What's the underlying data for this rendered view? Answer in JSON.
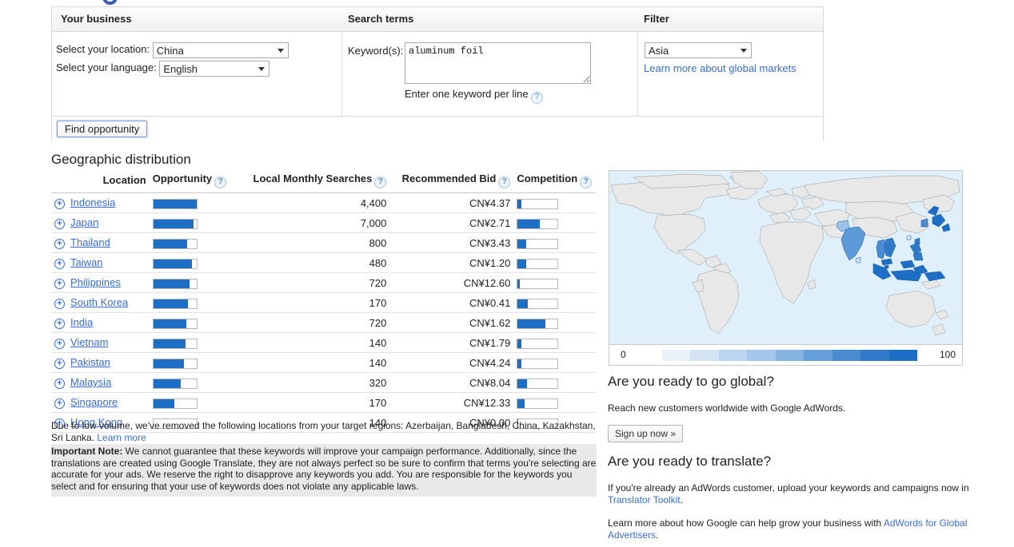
{
  "logo": {
    "icon": "google-logo-partial"
  },
  "form": {
    "headers": {
      "business": "Your business",
      "search_terms": "Search terms",
      "filter": "Filter"
    },
    "location_label": "Select your location:",
    "location_value": "China",
    "language_label": "Select your language:",
    "language_value": "English",
    "keywords_label": "Keyword(s):",
    "keywords_value": "aluminum foil",
    "keywords_hint": "Enter one keyword per line",
    "filter_value": "Asia",
    "filter_link": "Learn more about global markets",
    "submit_label": "Find opportunity",
    "help_icon": "?"
  },
  "geo": {
    "title": "Geographic distribution",
    "columns": [
      "Location",
      "Opportunity",
      "Local Monthly Searches",
      "Recommended Bid",
      "Competition"
    ],
    "expand_icon": "+"
  },
  "chart_data": {
    "type": "table",
    "title": "Geographic distribution",
    "columns": [
      "Location",
      "Opportunity",
      "Local Monthly Searches",
      "Recommended Bid",
      "Competition"
    ],
    "opportunity_scale": [
      0,
      100
    ],
    "competition_scale": [
      0,
      100
    ],
    "currency": "CN¥",
    "rows": [
      {
        "location": "Indonesia",
        "opportunity": 100,
        "searches": "4,400",
        "bid": "CN¥4.37",
        "competition": 9
      },
      {
        "location": "Japan",
        "opportunity": 93,
        "searches": "7,000",
        "bid": "CN¥2.71",
        "competition": 56
      },
      {
        "location": "Thailand",
        "opportunity": 78,
        "searches": "800",
        "bid": "CN¥3.43",
        "competition": 22
      },
      {
        "location": "Taiwan",
        "opportunity": 89,
        "searches": "480",
        "bid": "CN¥1.20",
        "competition": 22
      },
      {
        "location": "Philippines",
        "opportunity": 84,
        "searches": "720",
        "bid": "CN¥12.60",
        "competition": 6
      },
      {
        "location": "South Korea",
        "opportunity": 80,
        "searches": "170",
        "bid": "CN¥0.41",
        "competition": 26
      },
      {
        "location": "India",
        "opportunity": 76,
        "searches": "720",
        "bid": "CN¥1.62",
        "competition": 70
      },
      {
        "location": "Vietnam",
        "opportunity": 74,
        "searches": "140",
        "bid": "CN¥1.79",
        "competition": 10
      },
      {
        "location": "Pakistan",
        "opportunity": 70,
        "searches": "140",
        "bid": "CN¥4.24",
        "competition": 10
      },
      {
        "location": "Malaysia",
        "opportunity": 63,
        "searches": "320",
        "bid": "CN¥8.04",
        "competition": 24
      },
      {
        "location": "Singapore",
        "opportunity": 48,
        "searches": "170",
        "bid": "CN¥12.33",
        "competition": 17
      },
      {
        "location": "Hong Kong",
        "opportunity": 0,
        "searches": "140",
        "bid": "CN¥0.00",
        "competition": 2
      }
    ]
  },
  "notes": {
    "volume_text": "Due to low volume, we've removed the following locations from your target regions: Azerbaijan, Bangladesh, China, Kazakhstan, Sri Lanka. ",
    "volume_link": "Learn more",
    "important_label": "Important Note:",
    "important_text": " We cannot guarantee that these keywords will improve your campaign performance. Additionally, since the translations are created using Google Translate, they are not always perfect so be sure to confirm that terms you're selecting are accurate for your ads. We reserve the right to disapprove any keywords you add. You are responsible for the keywords you select and for ensuring that your use of keywords does not violate any applicable laws."
  },
  "map": {
    "legend_min": "0",
    "legend_max": "100",
    "ocean_color": "#dff0fb",
    "land_color": "#e8e8e8",
    "highlight_color": "#1c6fc4",
    "legend_steps": [
      "#e8f0f8",
      "#d4e4f4",
      "#bcd5ef",
      "#a3c6ea",
      "#85b3e2",
      "#65a0da",
      "#4a8cd2",
      "#2f7bca",
      "#1c6fc4"
    ]
  },
  "promo": {
    "heading1": "Are you ready to go global?",
    "text1": "Reach new customers worldwide with Google AdWords.",
    "signup_label": "Sign up now »",
    "heading2": "Are you ready to translate?",
    "text2a": "If you're already an AdWords customer, upload your keywords and campaigns now in ",
    "text2_link": "Translator Toolkit",
    "text2b": ".",
    "text3a": "Learn more about how Google can help grow your business with ",
    "text3_link": "AdWords for Global Advertisers",
    "text3b": "."
  }
}
